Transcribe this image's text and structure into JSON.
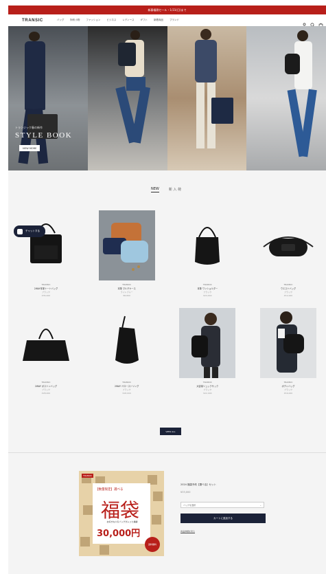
{
  "promo": {
    "text": "新春福袋セール・1/31(日)まで"
  },
  "header": {
    "logo": "TRANSIC",
    "nav": [
      "バッグ",
      "財布小物",
      "ファッション",
      "ビジネス",
      "レディース",
      "ギフト",
      "新着商品",
      "ブランド"
    ]
  },
  "hero": {
    "subtitle": "トランジック春の新作",
    "title": "STYLE BOOK",
    "button": "VIEW MORE"
  },
  "tabs": {
    "active": "NEW",
    "other": "新 入 荷"
  },
  "products": [
    {
      "brand": "TRANSIC",
      "name": "2WAY本革トートバッグ",
      "desc": "ブラック",
      "price": "¥35,000",
      "kind": "tote"
    },
    {
      "brand": "TRANSIC",
      "name": "本革 マルチケース",
      "desc": "ライトブルー",
      "price": "¥8,800",
      "kind": "wallet"
    },
    {
      "brand": "TRANSIC",
      "name": "本革 ワンショルダー",
      "desc": "ブラック",
      "price": "¥24,000",
      "kind": "bucket"
    },
    {
      "brand": "TRANSIC",
      "name": "ウエストバッグ",
      "desc": "ブラック",
      "price": "¥12,000",
      "kind": "waist"
    },
    {
      "brand": "TRANSIC",
      "name": "2WAY ボストンバッグ",
      "desc": "ブラック",
      "price": "¥28,000",
      "kind": "boston"
    },
    {
      "brand": "TRANSIC",
      "name": "2WAY ドローストリング",
      "desc": "ブラック",
      "price": "¥18,000",
      "kind": "drawstring"
    },
    {
      "brand": "TRANSIC",
      "name": "大容量リュックサック",
      "desc": "ブラック",
      "price": "¥22,000",
      "kind": "model1"
    },
    {
      "brand": "TRANSIC",
      "name": "ボディバッグ",
      "desc": "ブラック",
      "price": "¥16,000",
      "kind": "model2"
    }
  ],
  "chat": {
    "label": "チャットする"
  },
  "view_all": "VIEW ALL",
  "fukubukuro": {
    "tag": "TRANSIC",
    "top": "【数量限定】選べる",
    "big": "福袋",
    "line": "お好きな人気バッグが入った福袋",
    "amount": "30,000円",
    "badge": "送料無料"
  },
  "product_info": {
    "name": "2024 福袋予約【選べる】セット",
    "price": "¥33,000",
    "select": "バッグを選択",
    "add_button": "カートに追加する",
    "link": "商品詳細を見る"
  },
  "colors": {
    "accent": "#b81f1a",
    "navy": "#1b2238"
  }
}
